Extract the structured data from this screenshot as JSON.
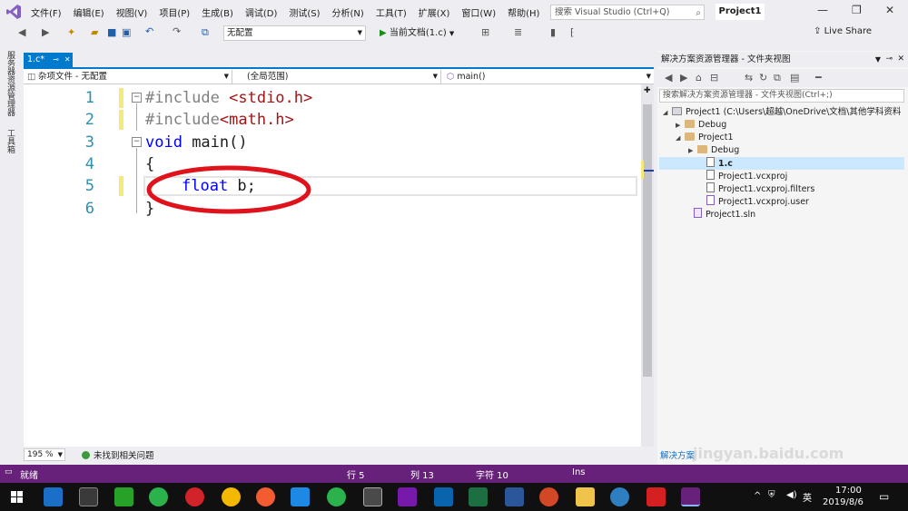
{
  "menubar": {
    "items": [
      "文件(F)",
      "编辑(E)",
      "视图(V)",
      "项目(P)",
      "生成(B)",
      "调试(D)",
      "测试(S)",
      "分析(N)",
      "工具(T)",
      "扩展(X)",
      "窗口(W)",
      "帮助(H)"
    ],
    "search_placeholder": "搜索 Visual Studio (Ctrl+Q)",
    "project_name": "Project1"
  },
  "toolbar": {
    "config": "无配置",
    "run_label": "当前文档(1.c)",
    "live_share": "Live Share"
  },
  "left_tabs": [
    "服务器资源管理器",
    "工具箱"
  ],
  "editor": {
    "tab_label": "1.c*",
    "nav": [
      "杂项文件 - 无配置",
      "(全局范围)",
      "main()"
    ],
    "line_numbers": [
      "1",
      "2",
      "3",
      "4",
      "5",
      "6"
    ],
    "zoom": "195 %",
    "issues": "未找到相关问题"
  },
  "code": {
    "l1a": "#include ",
    "l1b": "<stdio.h>",
    "l2a": "#include",
    "l2b": "<math.h>",
    "l3a": "void",
    "l3b": " main()",
    "l4": "{",
    "l5a": "float",
    "l5b": " b;",
    "l6": "}"
  },
  "solution": {
    "title": "解决方案资源管理器 - 文件夹视图",
    "search_placeholder": "搜索解决方案资源管理器 - 文件夹视图(Ctrl+;)",
    "tree": [
      "Project1 (C:\\Users\\超越\\OneDrive\\文档\\其他学科资料",
      "Debug",
      "Project1",
      "Debug",
      "1.c",
      "Project1.vcxproj",
      "Project1.vcxproj.filters",
      "Project1.vcxproj.user",
      "Project1.sln"
    ],
    "bottom_tab": "解决方案"
  },
  "statusbar": {
    "ready": "就绪",
    "row": "行 5",
    "col": "列 13",
    "char": "字符 10",
    "ins": "Ins"
  },
  "taskbar": {
    "lang": "英",
    "time": "17:00",
    "date": "2019/8/6"
  },
  "watermark": "jingyan.baidu.com",
  "colors": {
    "accent": "#007acc",
    "status": "#68217a",
    "keyword": "#0000ff",
    "string": "#a31515",
    "annotation": "#e0121b"
  }
}
